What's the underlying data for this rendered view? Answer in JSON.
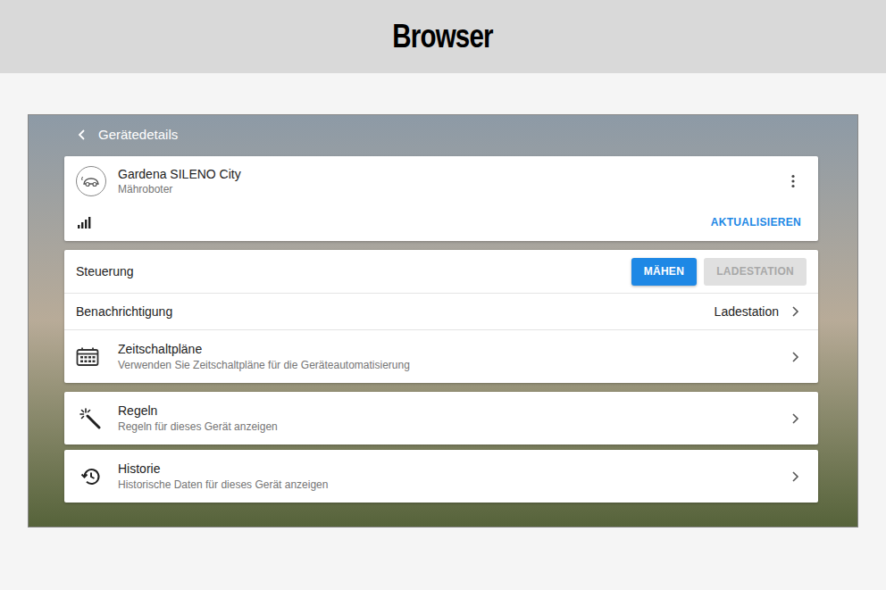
{
  "header": {
    "title": "Browser"
  },
  "nav": {
    "title": "Gerätedetails"
  },
  "device": {
    "name": "Gardena SILENO City",
    "type": "Mähroboter",
    "action": "AKTUALISIEREN",
    "signal_level": 1
  },
  "control": {
    "label": "Steuerung",
    "buttons": [
      {
        "label": "MÄHEN",
        "disabled": false
      },
      {
        "label": "LADESTATION",
        "disabled": true
      }
    ]
  },
  "notification": {
    "label": "Benachrichtigung",
    "value": "Ladestation"
  },
  "schedule": {
    "title": "Zeitschaltpläne",
    "subtitle": "Verwenden Sie Zeitschaltpläne für die Geräteautomatisierung"
  },
  "links": [
    {
      "kind": "rules",
      "title": "Regeln",
      "subtitle": "Regeln für dieses Gerät anzeigen"
    },
    {
      "kind": "history",
      "title": "Historie",
      "subtitle": "Historische Daten für dieses Gerät anzeigen"
    }
  ]
}
